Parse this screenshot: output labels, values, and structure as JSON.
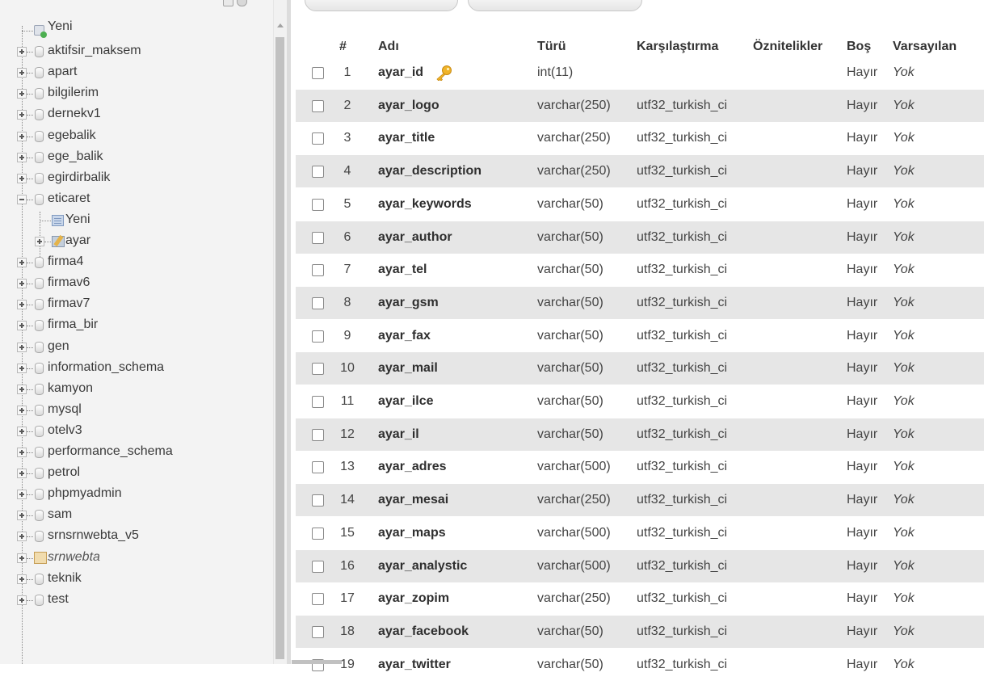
{
  "nav": {
    "tree": [
      {
        "label": "Yeni",
        "kind": "new-db"
      },
      {
        "label": "aktifsir_maksem",
        "kind": "db"
      },
      {
        "label": "apart",
        "kind": "db"
      },
      {
        "label": "bilgilerim",
        "kind": "db"
      },
      {
        "label": "dernekv1",
        "kind": "db"
      },
      {
        "label": "egebalik",
        "kind": "db"
      },
      {
        "label": "ege_balik",
        "kind": "db"
      },
      {
        "label": "egirdirbalik",
        "kind": "db"
      },
      {
        "label": "eticaret",
        "kind": "db-open"
      },
      {
        "label": "Yeni",
        "kind": "new-table"
      },
      {
        "label": "ayar",
        "kind": "table"
      },
      {
        "label": "firma4",
        "kind": "db"
      },
      {
        "label": "firmav6",
        "kind": "db"
      },
      {
        "label": "firmav7",
        "kind": "db"
      },
      {
        "label": "firma_bir",
        "kind": "db"
      },
      {
        "label": "gen",
        "kind": "db"
      },
      {
        "label": "information_schema",
        "kind": "db"
      },
      {
        "label": "kamyon",
        "kind": "db"
      },
      {
        "label": "mysql",
        "kind": "db"
      },
      {
        "label": "otelv3",
        "kind": "db"
      },
      {
        "label": "performance_schema",
        "kind": "db"
      },
      {
        "label": "petrol",
        "kind": "db"
      },
      {
        "label": "phpmyadmin",
        "kind": "db"
      },
      {
        "label": "sam",
        "kind": "db"
      },
      {
        "label": "srnsrnwebta_v5",
        "kind": "db"
      },
      {
        "label": "srnwebta",
        "kind": "db-locked"
      },
      {
        "label": "teknik",
        "kind": "db"
      },
      {
        "label": "test",
        "kind": "db"
      }
    ]
  },
  "table": {
    "headers": {
      "num": "#",
      "name": "Adı",
      "type": "Türü",
      "collation": "Karşılaştırma",
      "attributes": "Öznitelikler",
      "null": "Boş",
      "default": "Varsayılan"
    },
    "rows": [
      {
        "num": "1",
        "name": "ayar_id",
        "type": "int(11)",
        "collation": "",
        "null": "Hayır",
        "default": "Yok",
        "primary": true
      },
      {
        "num": "2",
        "name": "ayar_logo",
        "type": "varchar(250)",
        "collation": "utf32_turkish_ci",
        "null": "Hayır",
        "default": "Yok"
      },
      {
        "num": "3",
        "name": "ayar_title",
        "type": "varchar(250)",
        "collation": "utf32_turkish_ci",
        "null": "Hayır",
        "default": "Yok"
      },
      {
        "num": "4",
        "name": "ayar_description",
        "type": "varchar(250)",
        "collation": "utf32_turkish_ci",
        "null": "Hayır",
        "default": "Yok"
      },
      {
        "num": "5",
        "name": "ayar_keywords",
        "type": "varchar(50)",
        "collation": "utf32_turkish_ci",
        "null": "Hayır",
        "default": "Yok"
      },
      {
        "num": "6",
        "name": "ayar_author",
        "type": "varchar(50)",
        "collation": "utf32_turkish_ci",
        "null": "Hayır",
        "default": "Yok"
      },
      {
        "num": "7",
        "name": "ayar_tel",
        "type": "varchar(50)",
        "collation": "utf32_turkish_ci",
        "null": "Hayır",
        "default": "Yok"
      },
      {
        "num": "8",
        "name": "ayar_gsm",
        "type": "varchar(50)",
        "collation": "utf32_turkish_ci",
        "null": "Hayır",
        "default": "Yok"
      },
      {
        "num": "9",
        "name": "ayar_fax",
        "type": "varchar(50)",
        "collation": "utf32_turkish_ci",
        "null": "Hayır",
        "default": "Yok"
      },
      {
        "num": "10",
        "name": "ayar_mail",
        "type": "varchar(50)",
        "collation": "utf32_turkish_ci",
        "null": "Hayır",
        "default": "Yok"
      },
      {
        "num": "11",
        "name": "ayar_ilce",
        "type": "varchar(50)",
        "collation": "utf32_turkish_ci",
        "null": "Hayır",
        "default": "Yok"
      },
      {
        "num": "12",
        "name": "ayar_il",
        "type": "varchar(50)",
        "collation": "utf32_turkish_ci",
        "null": "Hayır",
        "default": "Yok"
      },
      {
        "num": "13",
        "name": "ayar_adres",
        "type": "varchar(500)",
        "collation": "utf32_turkish_ci",
        "null": "Hayır",
        "default": "Yok"
      },
      {
        "num": "14",
        "name": "ayar_mesai",
        "type": "varchar(250)",
        "collation": "utf32_turkish_ci",
        "null": "Hayır",
        "default": "Yok"
      },
      {
        "num": "15",
        "name": "ayar_maps",
        "type": "varchar(500)",
        "collation": "utf32_turkish_ci",
        "null": "Hayır",
        "default": "Yok"
      },
      {
        "num": "16",
        "name": "ayar_analystic",
        "type": "varchar(500)",
        "collation": "utf32_turkish_ci",
        "null": "Hayır",
        "default": "Yok"
      },
      {
        "num": "17",
        "name": "ayar_zopim",
        "type": "varchar(250)",
        "collation": "utf32_turkish_ci",
        "null": "Hayır",
        "default": "Yok"
      },
      {
        "num": "18",
        "name": "ayar_facebook",
        "type": "varchar(50)",
        "collation": "utf32_turkish_ci",
        "null": "Hayır",
        "default": "Yok"
      },
      {
        "num": "19",
        "name": "ayar_twitter",
        "type": "varchar(50)",
        "collation": "utf32_turkish_ci",
        "null": "Hayır",
        "default": "Yok"
      }
    ]
  },
  "colors": {
    "nav_bg": "#f3f3f3",
    "row_alt": "#e6e6e6",
    "key_icon": "#f0b429"
  }
}
